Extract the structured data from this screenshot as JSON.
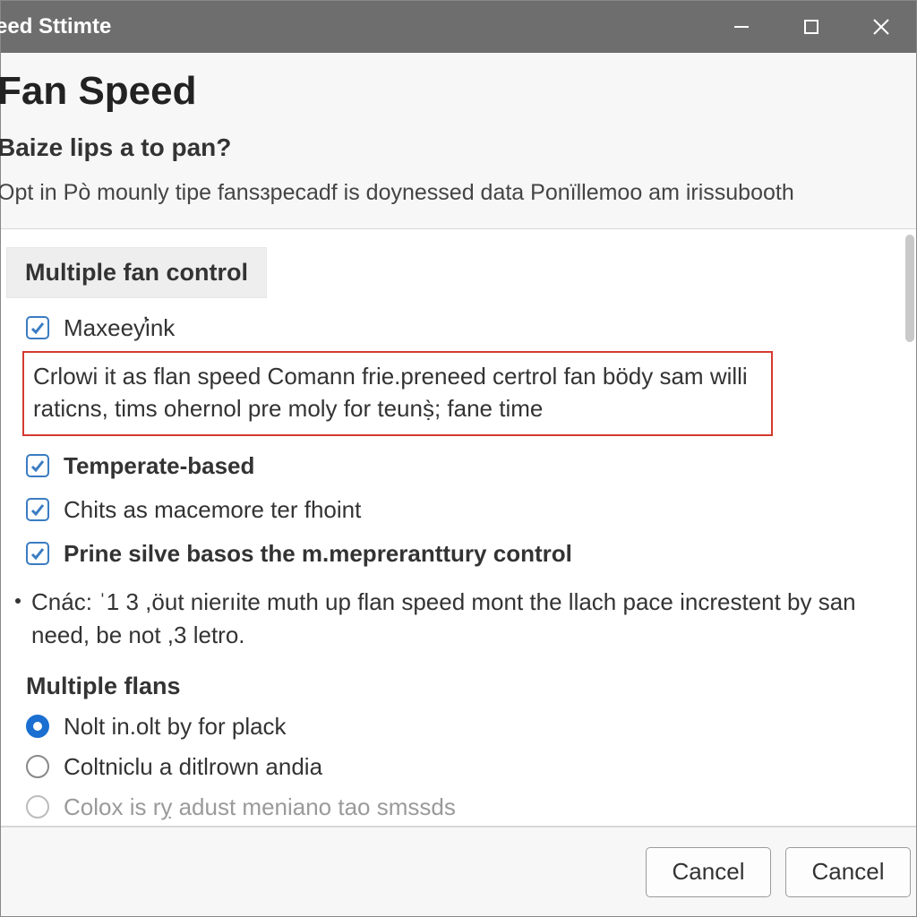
{
  "window": {
    "title": "eed Sttimte"
  },
  "header": {
    "title": "Fan Speed",
    "subtitle": "Baize lips a to pan?",
    "description": "Opt in Pò mounly tipe fansɜpecadf is doynessed data Ponïllemoo am irissubooth"
  },
  "section1": {
    "heading": "Multiple fan control",
    "opt1_label": "Maxeey̕ink",
    "highlight_text": "Crlowi it as flan speed Comann frie.preneed certrol fan bödy sam willi raticns, tims ohernol pre moly for teunṣ̀; fane time",
    "opt2_label": "Temperate-based",
    "opt3_label": "Chits as macemore ter fhoint",
    "opt4_label": "Prine silve basos the m.mepreranttury control",
    "bullet_text": "Cnác: ˈ1 3 ,öut nierıite muth up flan speed mont the llach pace increstent by san need, be not ,3 letro."
  },
  "section2": {
    "heading": "Multiple flans",
    "radio1_label": "Nolt in.olt by for plack",
    "radio2_label": "Coltniclu a ditlrown andia",
    "radio3_label": "Colox is rỵ adust meniano tao smssds"
  },
  "footer": {
    "btn1_label": "Cancel",
    "btn2_label": "Cancel"
  }
}
